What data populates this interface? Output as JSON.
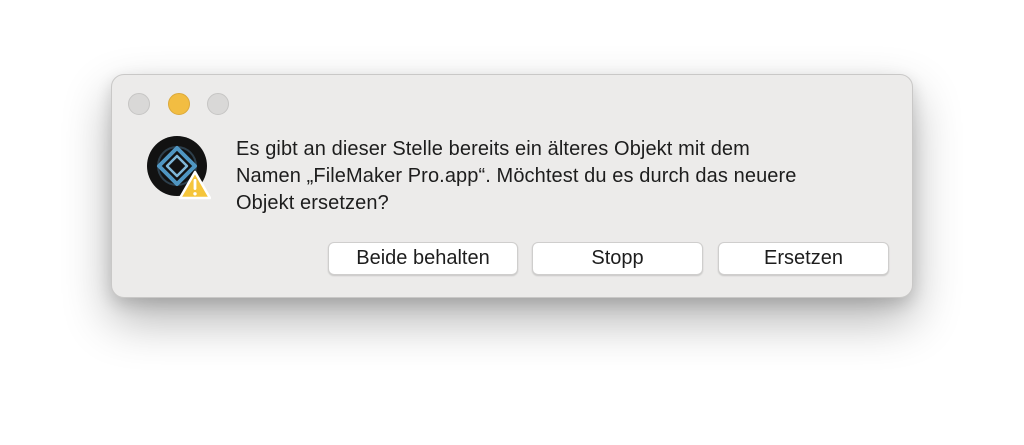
{
  "dialog": {
    "message_line1": "Es gibt an dieser Stelle bereits ein älteres Objekt mit dem",
    "message_line2": "Namen „FileMaker Pro.app“. Möchtest du es durch das neuere",
    "message_line3": "Objekt ersetzen?",
    "buttons": {
      "keep_both": "Beide behalten",
      "stop": "Stopp",
      "replace": "Ersetzen"
    }
  },
  "icons": {
    "app": "filemaker-pro-icon",
    "badge": "warning-badge-icon"
  },
  "colors": {
    "dialog_background": "#ecebea",
    "traffic_inactive": "#d9d8d7",
    "traffic_minimize": "#f2bd42",
    "app_icon_background": "#121212",
    "app_icon_accent": "#4f96c2",
    "warning_yellow": "#f5c53b",
    "button_background": "#ffffff",
    "text": "#1d1d1d"
  }
}
